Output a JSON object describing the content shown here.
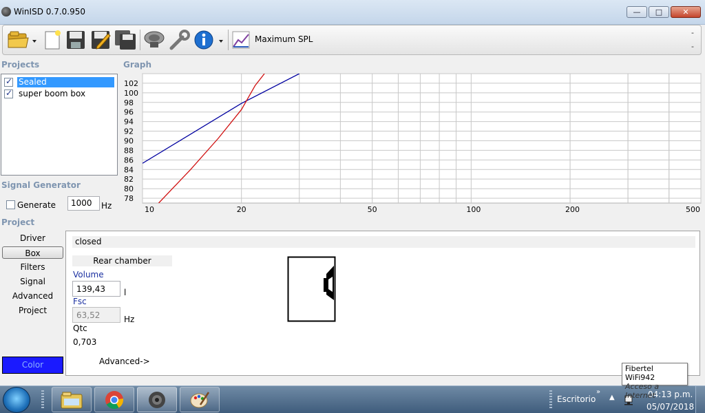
{
  "window": {
    "title": "WinISD 0.7.0.950"
  },
  "toolbar": {
    "buttons": [
      "open-icon",
      "new-project-icon",
      "save-icon",
      "save-as-icon",
      "save-all-icon",
      "driver-icon",
      "tools-icon",
      "info-icon"
    ],
    "graph_type_label": "Maximum SPL",
    "dash_top": "-",
    "dash_bottom": "-"
  },
  "projects": {
    "title": "Projects",
    "items": [
      {
        "name": "Sealed",
        "checked": true,
        "selected": true
      },
      {
        "name": "super boom box",
        "checked": true,
        "selected": false
      }
    ]
  },
  "graph": {
    "title": "Graph"
  },
  "chart_data": {
    "type": "line",
    "title": "",
    "xscale": "log",
    "xlim": [
      10,
      500
    ],
    "ylim": [
      77,
      104
    ],
    "x_ticks": [
      10,
      20,
      50,
      100,
      200,
      500
    ],
    "y_ticks": [
      78,
      80,
      82,
      84,
      86,
      88,
      90,
      92,
      94,
      96,
      98,
      100,
      102
    ],
    "grid": true,
    "series": [
      {
        "color": "#0000a0",
        "x": [
          10,
          20,
          30
        ],
        "y": [
          85.3,
          97.8,
          104
        ]
      },
      {
        "color": "#d01010",
        "x": [
          11.2,
          14,
          17,
          20,
          22,
          23.5
        ],
        "y": [
          77,
          84,
          90.5,
          96.5,
          101.5,
          104
        ]
      }
    ]
  },
  "signal_generator": {
    "title": "Signal Generator",
    "generate_label": "Generate",
    "generate_checked": false,
    "frequency": "1000",
    "unit": "Hz"
  },
  "project_nav": {
    "title": "Project",
    "items": [
      "Driver",
      "Box",
      "Filters",
      "Signal",
      "Advanced",
      "Project"
    ],
    "active": "Box",
    "color_label": "Color",
    "color": "#1a1aff"
  },
  "box": {
    "type": "closed",
    "rear_chamber_label": "Rear chamber",
    "volume_label": "Volume",
    "volume_value": "139,43",
    "volume_unit": "l",
    "fsc_label": "Fsc",
    "fsc_value": "63,52",
    "fsc_unit": "Hz",
    "qtc_label": "Qtc",
    "qtc_value": "0,703",
    "advanced_link": "Advanced->"
  },
  "tooltip": {
    "line1": "Fibertel WiFi942",
    "line2": "Acceso a Internet"
  },
  "taskbar": {
    "apps": [
      "file-explorer-icon",
      "chrome-icon",
      "winisd-icon",
      "paint-icon"
    ],
    "desktop_label": "Escritorio",
    "time": "04:13 p.m.",
    "date": "05/07/2018"
  }
}
